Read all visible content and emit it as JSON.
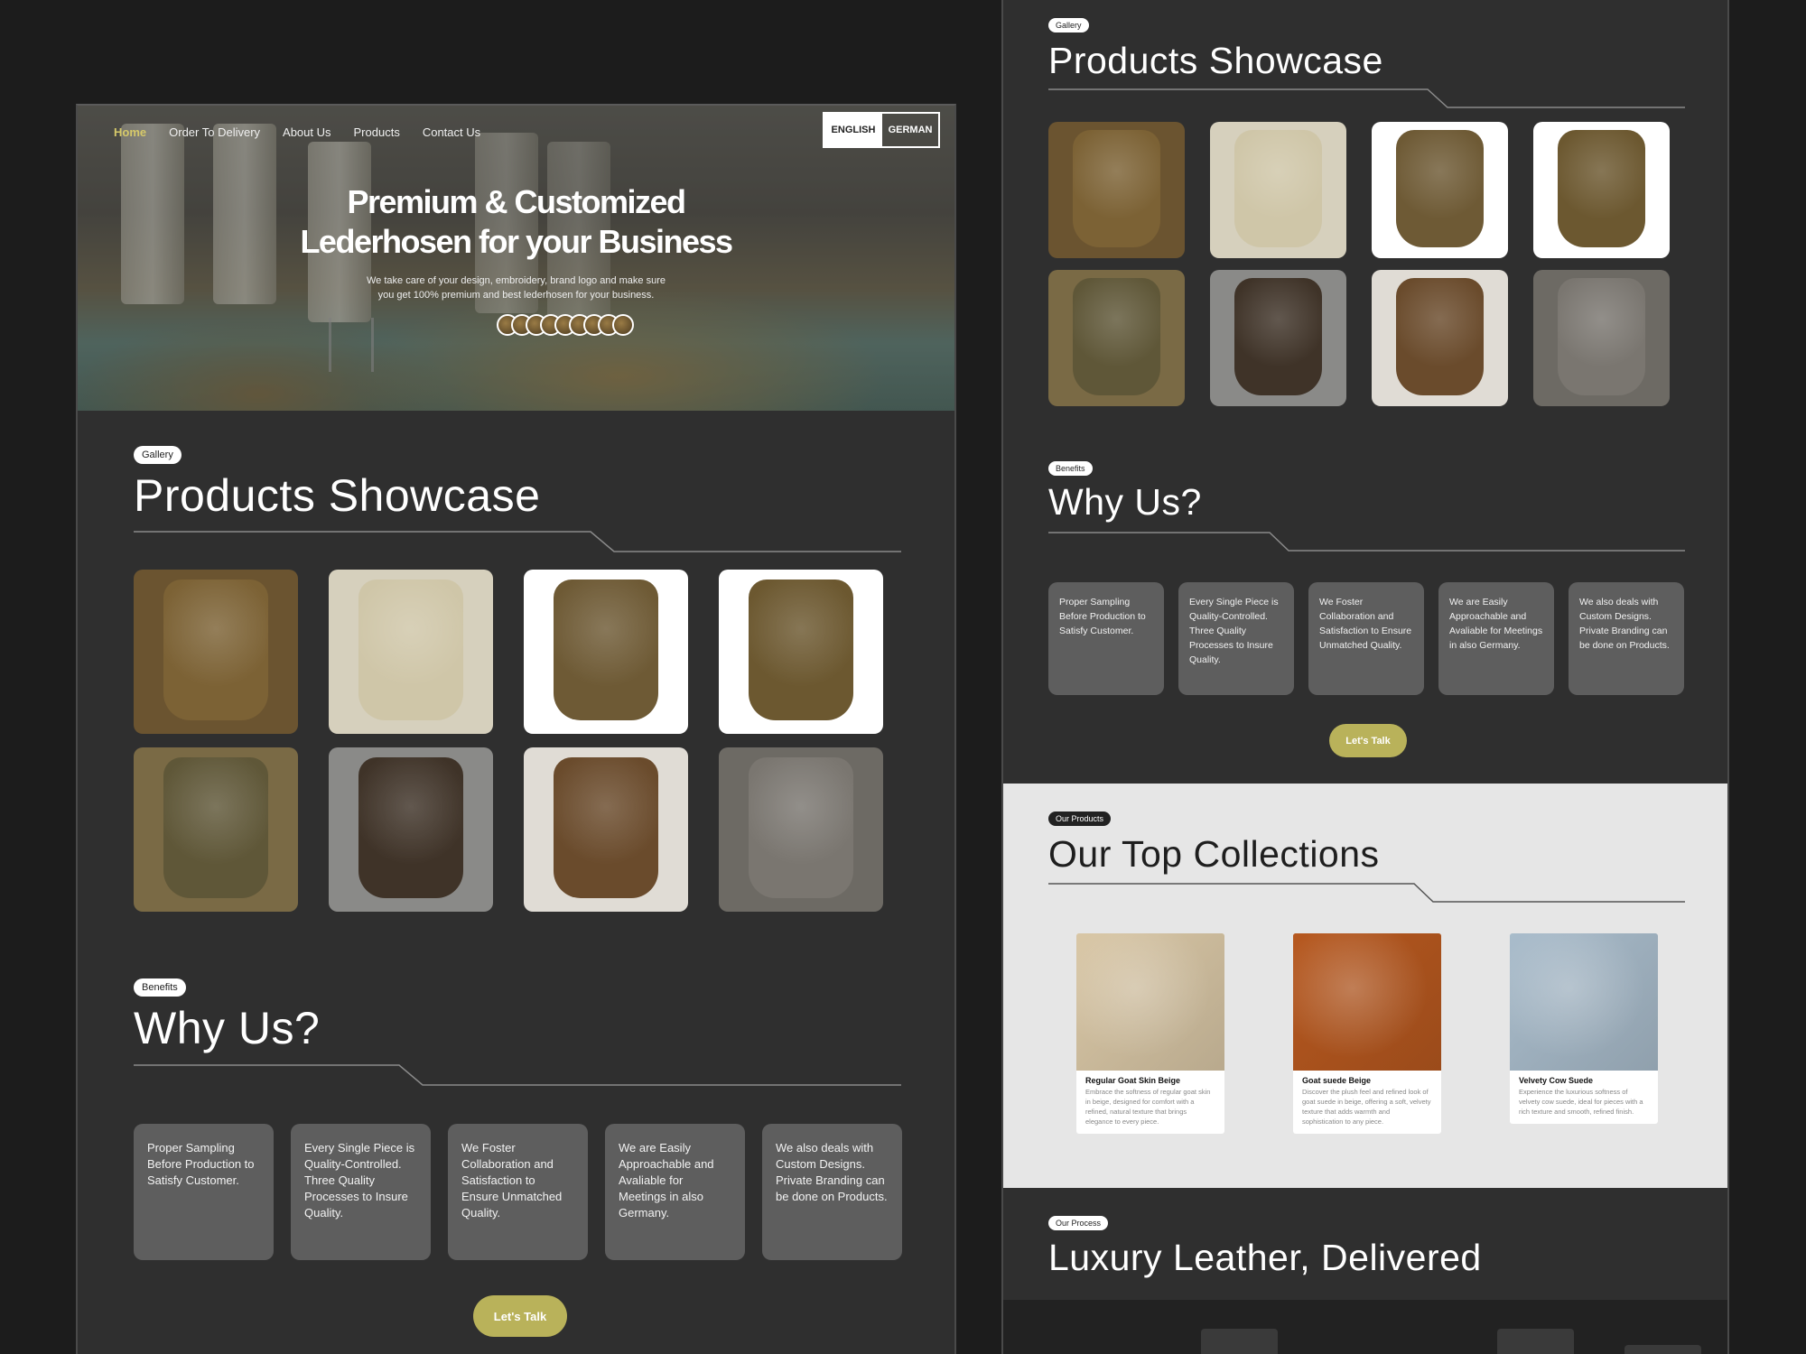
{
  "nav": {
    "items": [
      "Home",
      "Order To Delivery",
      "About Us",
      "Products",
      "Contact Us"
    ],
    "active": "Home"
  },
  "lang": {
    "english": "ENGLISH",
    "german": "GERMAN"
  },
  "hero": {
    "title_line1": "Premium & Customized",
    "title_line2": "Lederhosen for your Business",
    "subtitle_line1": "We take care of your design, embroidery, brand logo and make sure",
    "subtitle_line2": "you get 100% premium and best lederhosen for your business."
  },
  "gallery": {
    "badge": "Gallery",
    "title": "Products Showcase"
  },
  "benefits": {
    "badge": "Benefits",
    "title": "Why Us?",
    "cards": [
      "Proper Sampling Before Production to Satisfy Customer.",
      "Every Single Piece is Quality-Controlled. Three Quality Processes to Insure Quality.",
      "We Foster Collaboration and Satisfaction to Ensure Unmatched Quality.",
      "We are Easily Approachable and Avaliable for Meetings in also Germany.",
      "We also deals with Custom Designs. Private Branding can be done on Products."
    ],
    "cta": "Let's Talk"
  },
  "collections": {
    "badge": "Our Products",
    "title": "Our Top Collections",
    "items": [
      {
        "name": "Regular Goat Skin Beige",
        "desc": "Embrace the softness of regular goat skin in beige, designed for comfort with a refined, natural texture that brings elegance to every piece.",
        "color": "#d9c7a6"
      },
      {
        "name": "Goat suede Beige",
        "desc": "Discover the plush feel and refined look of goat suede in beige, offering a soft, velvety texture that adds warmth and sophistication to any piece.",
        "color": "#b6581f"
      },
      {
        "name": "Velvety Cow Suede",
        "desc": "Experience the luxurious softness of velvety cow suede, ideal for pieces with a rich texture and smooth, refined finish.",
        "color": "#a9bccb"
      }
    ]
  },
  "process": {
    "badge": "Our Process",
    "title": "Luxury Leather, Delivered"
  },
  "colors": {
    "accent": "#b9b25a",
    "nav_active": "#d6c96a",
    "panel": "#2f2f2f",
    "card": "#5e5e5e"
  },
  "gallery_tiles": [
    {
      "desc": "front of brown lederhosen worn",
      "bg": "#6b5430",
      "subject": "#7c6235"
    },
    {
      "desc": "beige suede lederhosen",
      "bg": "#d6d0bd",
      "subject": "#cfc6a8"
    },
    {
      "desc": "man jumping in lederhosen",
      "bg": "#ffffff",
      "subject": "#6e5a35"
    },
    {
      "desc": "side view brown lederhosen",
      "bg": "#ffffff",
      "subject": "#6c5830"
    },
    {
      "desc": "leather pieces on workbench",
      "bg": "#7a6a45",
      "subject": "#5f5738"
    },
    {
      "desc": "dark lederhosen on grey fabric",
      "bg": "#8a8a88",
      "subject": "#3f3328"
    },
    {
      "desc": "brown lederhosen laid flat",
      "bg": "#e0dcd5",
      "subject": "#6a4b2c"
    },
    {
      "desc": "grey suede with embroidery",
      "bg": "#6d6a64",
      "subject": "#7a7670"
    }
  ]
}
